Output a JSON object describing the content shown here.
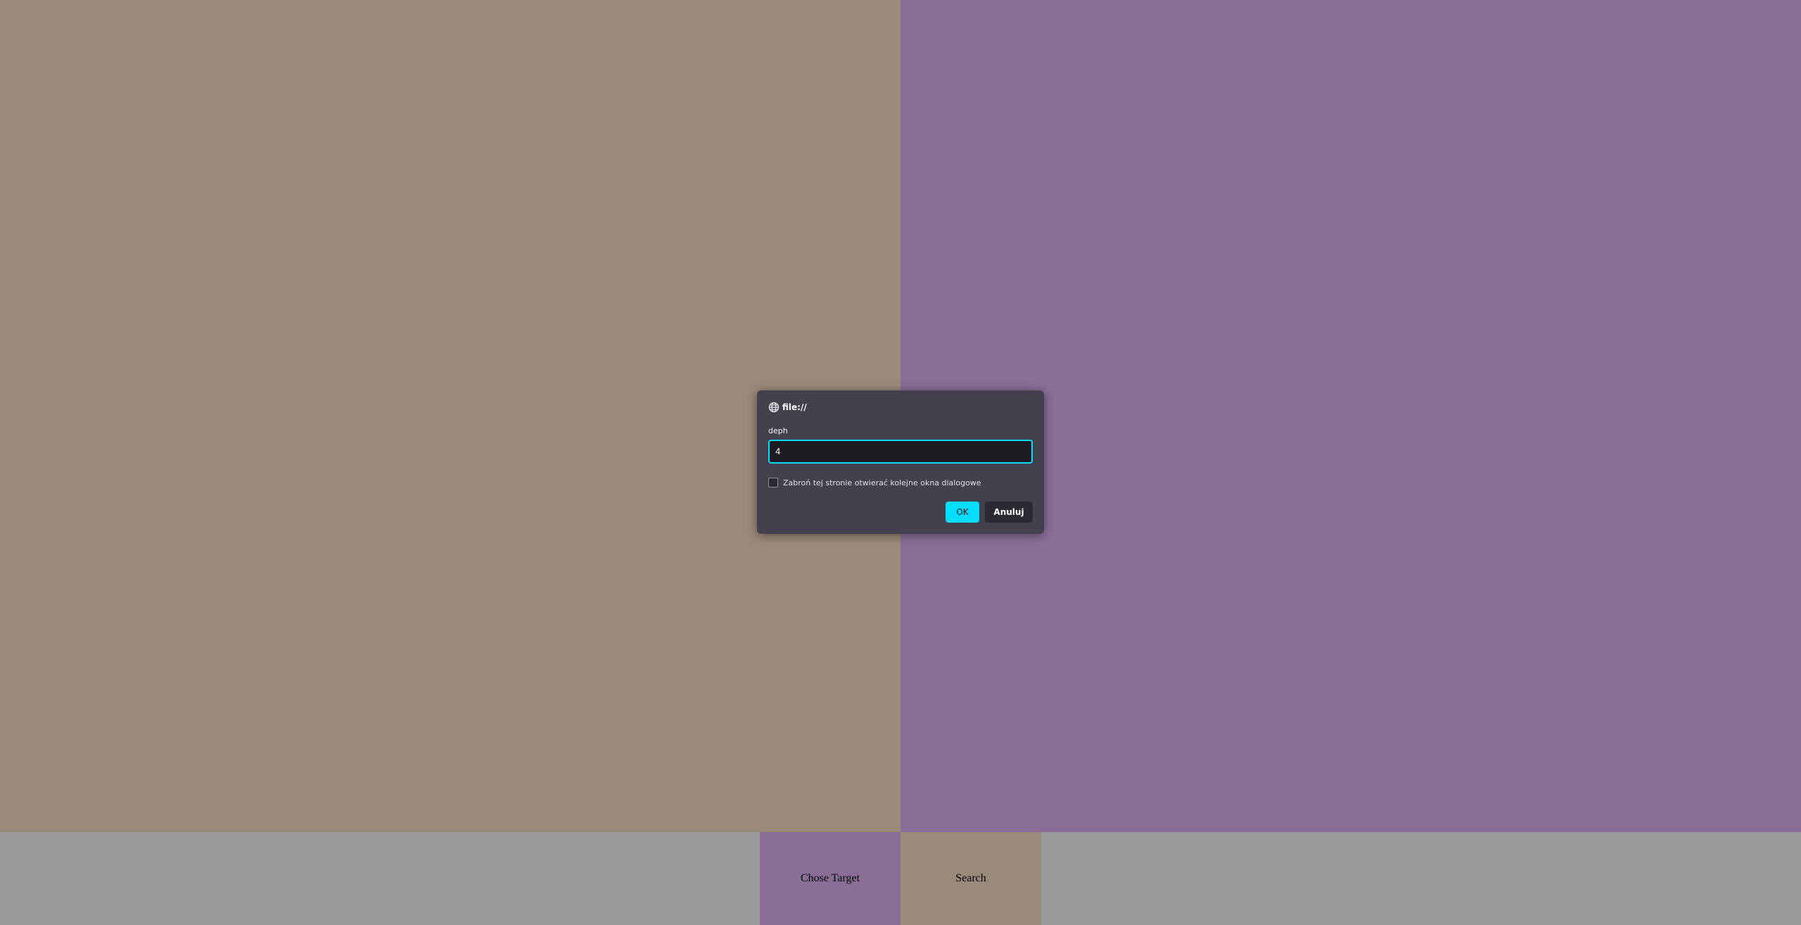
{
  "colors": {
    "left_panel": "#9a8a7a",
    "right_panel": "#8a6e98",
    "bottom_bar": "#9b9b9b",
    "chose_target_button": "#8a6e98",
    "search_button": "#9a8a7a",
    "dialog_background": "#42414d",
    "accent": "#00ddff"
  },
  "toolbar": {
    "chose_target_label": "Chose Target",
    "search_label": "Search"
  },
  "dialog": {
    "icon": "globe-icon",
    "title": "file://",
    "prompt_label": "deph",
    "input_value": "4",
    "checkbox_label": "Zabroń tej stronie otwierać kolejne okna dialogowe",
    "checkbox_checked": false,
    "ok_label": "OK",
    "cancel_label": "Anuluj"
  }
}
